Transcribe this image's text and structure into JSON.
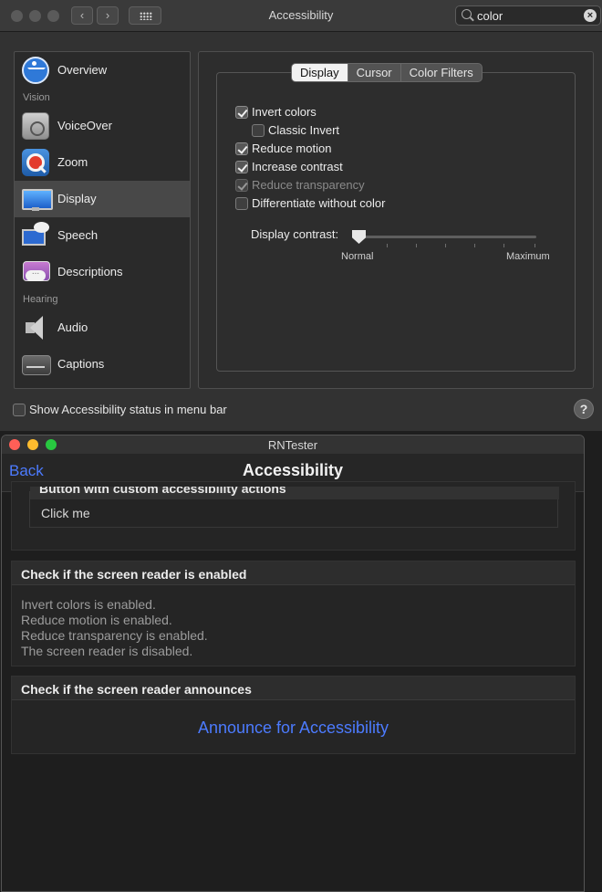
{
  "prefs": {
    "window_title": "Accessibility",
    "search_value": "color",
    "sidebar": {
      "items": [
        {
          "label": "Overview",
          "icon": "overview-icon"
        },
        {
          "label": "VoiceOver",
          "icon": "voiceover-icon"
        },
        {
          "label": "Zoom",
          "icon": "zoom-icon"
        },
        {
          "label": "Display",
          "icon": "display-icon",
          "selected": true
        },
        {
          "label": "Speech",
          "icon": "speech-icon"
        },
        {
          "label": "Descriptions",
          "icon": "descriptions-icon"
        },
        {
          "label": "Audio",
          "icon": "audio-icon"
        },
        {
          "label": "Captions",
          "icon": "captions-icon"
        }
      ],
      "sections": [
        "Vision",
        "Hearing"
      ]
    },
    "tabs": [
      "Display",
      "Cursor",
      "Color Filters"
    ],
    "active_tab": "Display",
    "options": [
      {
        "label": "Invert colors",
        "checked": true
      },
      {
        "label": "Classic Invert",
        "checked": false
      },
      {
        "label": "Reduce motion",
        "checked": true
      },
      {
        "label": "Increase contrast",
        "checked": true
      },
      {
        "label": "Reduce transparency",
        "checked": true,
        "disabled": true
      },
      {
        "label": "Differentiate without color",
        "checked": false
      }
    ],
    "contrast": {
      "label": "Display contrast:",
      "min_label": "Normal",
      "max_label": "Maximum",
      "level": 0
    },
    "status_bar_option": {
      "label": "Show Accessibility status in menu bar",
      "checked": false
    },
    "help_label": "?"
  },
  "rntester": {
    "window_title": "RNTester",
    "back_label": "Back",
    "heading": "Accessibility",
    "custom_actions": {
      "header": "Button with custom accessibility actions",
      "button_label": "Click me"
    },
    "screen_reader_check": {
      "header": "Check if the screen reader is enabled",
      "lines": [
        "Invert colors is enabled.",
        "Reduce motion is enabled.",
        "Reduce transparency is enabled.",
        "The screen reader is disabled."
      ]
    },
    "announce_check": {
      "header": "Check if the screen reader announces",
      "button_label": "Announce for Accessibility"
    }
  },
  "colors": {
    "link_blue": "#4c7bff",
    "close_red": "#fe5f57",
    "minimize_yellow": "#febc2e",
    "zoom_green": "#28c840"
  }
}
